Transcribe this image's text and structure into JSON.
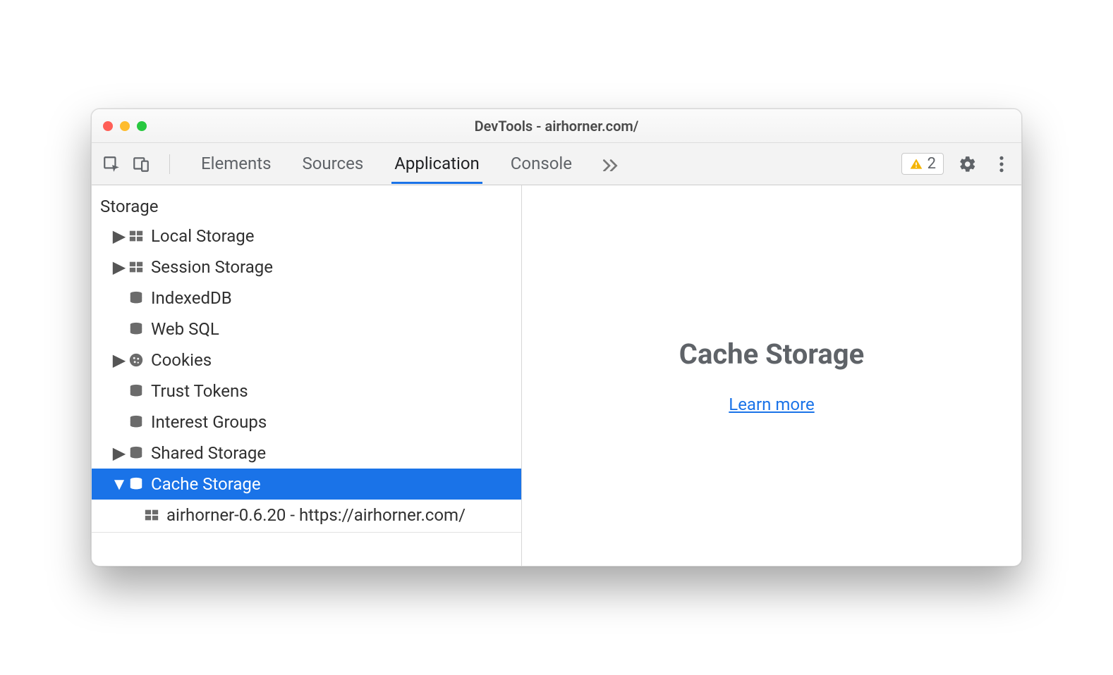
{
  "window": {
    "title": "DevTools - airhorner.com/"
  },
  "toolbar": {
    "tabs": [
      {
        "label": "Elements"
      },
      {
        "label": "Sources"
      },
      {
        "label": "Application"
      },
      {
        "label": "Console"
      }
    ],
    "active_tab": "Application",
    "warning_count": "2"
  },
  "sidebar": {
    "section": "Storage",
    "items": [
      {
        "label": "Local Storage",
        "icon": "grid",
        "expandable": true,
        "expanded": false
      },
      {
        "label": "Session Storage",
        "icon": "grid",
        "expandable": true,
        "expanded": false
      },
      {
        "label": "IndexedDB",
        "icon": "db",
        "expandable": false
      },
      {
        "label": "Web SQL",
        "icon": "db",
        "expandable": false
      },
      {
        "label": "Cookies",
        "icon": "cookie",
        "expandable": true,
        "expanded": false
      },
      {
        "label": "Trust Tokens",
        "icon": "db",
        "expandable": false
      },
      {
        "label": "Interest Groups",
        "icon": "db",
        "expandable": false
      },
      {
        "label": "Shared Storage",
        "icon": "db",
        "expandable": true,
        "expanded": false
      },
      {
        "label": "Cache Storage",
        "icon": "db",
        "expandable": true,
        "expanded": true,
        "selected": true
      }
    ],
    "cache_child": {
      "label": "airhorner-0.6.20 - https://airhorner.com/"
    }
  },
  "main": {
    "heading": "Cache Storage",
    "link": "Learn more"
  }
}
